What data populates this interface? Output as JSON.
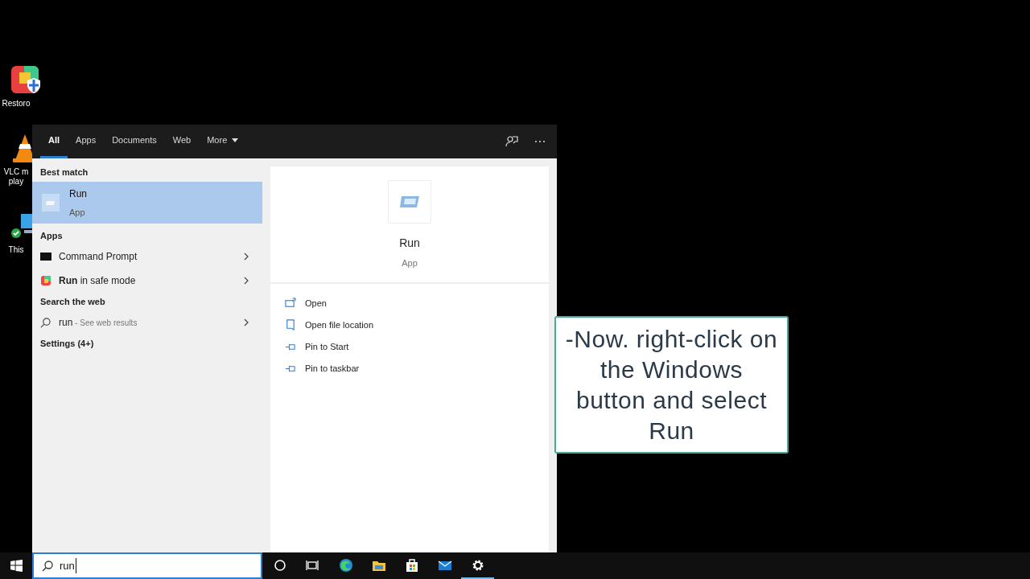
{
  "desktop_icons": [
    {
      "kind": "restoro",
      "lines": [
        "Restoro"
      ]
    },
    {
      "kind": "vlc",
      "lines": [
        "VLC m",
        "play"
      ]
    },
    {
      "kind": "pc",
      "lines": [
        "This"
      ]
    }
  ],
  "search_menu": {
    "tabs": [
      {
        "label": "All",
        "selected": true
      },
      {
        "label": "Apps",
        "selected": false
      },
      {
        "label": "Documents",
        "selected": false
      },
      {
        "label": "Web",
        "selected": false
      },
      {
        "label": "More",
        "selected": false,
        "dropdown": true
      }
    ],
    "best_match": {
      "heading": "Best match",
      "title": "Run",
      "subtitle": "App",
      "selected": true
    },
    "apps": {
      "heading": "Apps",
      "items": [
        {
          "kind": "cmd",
          "label": "Command Prompt"
        },
        {
          "kind": "safe",
          "label": "**Run** in safe mode"
        }
      ]
    },
    "web": {
      "heading": "Search the web",
      "query": "run",
      "hint": " - See web results"
    },
    "settings": {
      "heading": "Settings (4+)"
    },
    "detail": {
      "title": "Run",
      "subtitle": "App",
      "actions": [
        {
          "kind": "open",
          "label": "Open"
        },
        {
          "kind": "location",
          "label": "Open file location"
        },
        {
          "kind": "pin",
          "label": "Pin to Start"
        },
        {
          "kind": "pin",
          "label": "Pin to taskbar"
        }
      ]
    }
  },
  "taskbar": {
    "search_value": "run",
    "apps": [
      {
        "kind": "cortana",
        "active": false
      },
      {
        "kind": "taskview",
        "active": false
      },
      {
        "kind": "edge",
        "active": false
      },
      {
        "kind": "explorer",
        "active": false
      },
      {
        "kind": "store",
        "active": false
      },
      {
        "kind": "mail",
        "active": false
      },
      {
        "kind": "settings",
        "active": true
      }
    ]
  },
  "caption": {
    "text": "-Now. right-click on the Windows button and select Run"
  }
}
